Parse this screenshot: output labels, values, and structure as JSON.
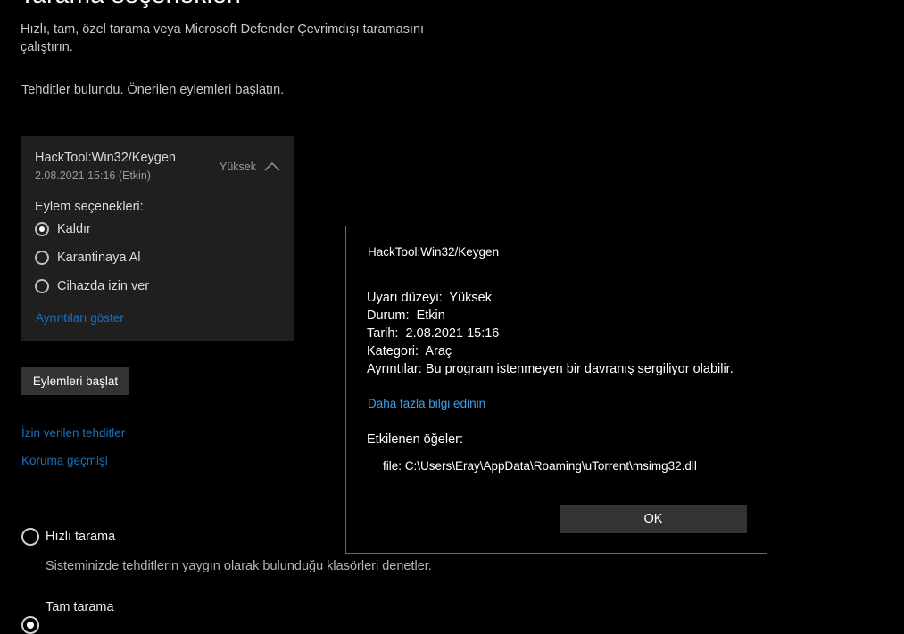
{
  "page": {
    "title": "Tarama seçenekleri",
    "description": "Hızlı, tam, özel tarama veya Microsoft Defender Çevrimdışı taramasını çalıştırın.",
    "threats_message": "Tehditler bulundu. Önerilen eylemleri başlatın."
  },
  "threat_card": {
    "name": "HackTool:Win32/Keygen",
    "date": "2.08.2021 15:16 (Etkin)",
    "severity": "Yüksek",
    "actions_label": "Eylem seçenekleri:",
    "options": [
      {
        "label": "Kaldır",
        "selected": true
      },
      {
        "label": "Karantinaya Al",
        "selected": false
      },
      {
        "label": "Cihazda izin ver",
        "selected": false
      }
    ],
    "details_link": "Ayrıntıları göster"
  },
  "start_actions_button": "Eylemleri başlat",
  "links": {
    "allowed_threats": "İzin verilen tehditler",
    "protection_history": "Koruma geçmişi"
  },
  "scan_options": [
    {
      "label": "Hızlı tarama",
      "description": "Sisteminizde tehditlerin yaygın olarak bulunduğu klasörleri denetler.",
      "selected": false
    },
    {
      "label": "Tam tarama",
      "selected": true
    }
  ],
  "dialog": {
    "title": "HackTool:Win32/Keygen",
    "alert_level_label": "Uyarı düzeyi:",
    "alert_level": "Yüksek",
    "status_label": "Durum:",
    "status": "Etkin",
    "date_label": "Tarih:",
    "date": "2.08.2021 15:16",
    "category_label": "Kategori:",
    "category": "Araç",
    "details_label": "Ayrıntılar:",
    "details": "Bu program istenmeyen bir davranış sergiliyor olabilir.",
    "learn_more_link": "Daha fazla bilgi edinin",
    "affected_items_label": "Etkilenen öğeler:",
    "affected_file": "file: C:\\Users\\Eray\\AppData\\Roaming\\uTorrent\\msimg32.dll",
    "ok_button": "OK"
  },
  "colors": {
    "background": "#000000",
    "card": "#1f1f1f",
    "link": "#1f6fb8",
    "dialog_link": "#3f9ee8",
    "button": "#333333"
  }
}
